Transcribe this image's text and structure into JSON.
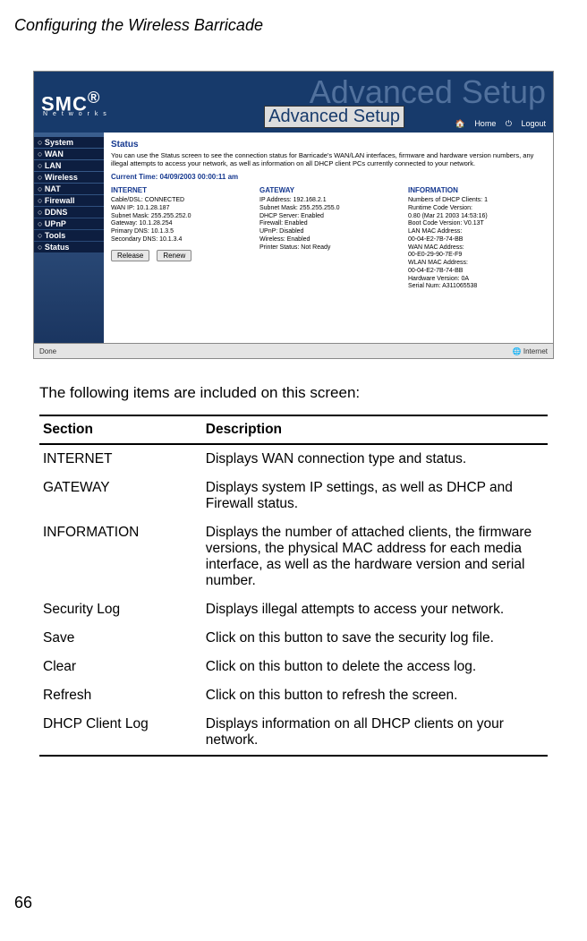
{
  "header": "Configuring the Wireless Barricade",
  "page_number": "66",
  "screenshot": {
    "brand": "SMC",
    "brand_sub": "N e t w o r k s",
    "watermark": "Advanced Setup",
    "watermark_label": "Advanced Setup",
    "nav_home": "Home",
    "nav_logout": "Logout",
    "sidebar_items": [
      "System",
      "WAN",
      "LAN",
      "Wireless",
      "NAT",
      "Firewall",
      "DDNS",
      "UPnP",
      "Tools",
      "Status"
    ],
    "title": "Status",
    "description": "You can use the Status screen to see the connection status for Barricade's WAN/LAN interfaces, firmware and hardware version numbers, any illegal attempts to access your network, as well as information on all DHCP client PCs currently connected to your network.",
    "current_time_label": "Current Time: 04/09/2003 00:00:11 am",
    "col_internet": {
      "head": "INTERNET",
      "lines": [
        "Cable/DSL: CONNECTED",
        "WAN IP: 10.1.28.187",
        "Subnet Mask: 255.255.252.0",
        "Gateway: 10.1.28.254",
        "Primary DNS: 10.1.3.5",
        "Secondary DNS: 10.1.3.4"
      ]
    },
    "col_gateway": {
      "head": "GATEWAY",
      "lines": [
        "IP Address: 192.168.2.1",
        "Subnet Mask: 255.255.255.0",
        "DHCP Server: Enabled",
        "Firewall: Enabled",
        "UPnP: Disabled",
        "Wireless: Enabled",
        "Printer Status: Not Ready"
      ]
    },
    "col_information": {
      "head": "INFORMATION",
      "lines": [
        "Numbers of DHCP Clients: 1",
        "Runtime Code Version:",
        " 0.80 (Mar 21 2003 14:53:16)",
        "Boot Code Version: V0.13T",
        "LAN MAC Address:",
        " 00-04-E2-7B-74-BB",
        "WAN MAC Address:",
        " 00-E0-29-90-7E-F9",
        "WLAN MAC Address:",
        " 00-04-E2-7B-74-BB",
        "Hardware Version: 0A",
        "Serial Num: A311065538"
      ]
    },
    "btn_release": "Release",
    "btn_renew": "Renew",
    "status_done": "Done",
    "status_zone": "Internet"
  },
  "body_para": "The following items are included on this screen:",
  "table": {
    "head_section": "Section",
    "head_desc": "Description",
    "rows": [
      {
        "section": "INTERNET",
        "desc": "Displays WAN connection type and status."
      },
      {
        "section": "GATEWAY",
        "desc": "Displays system IP settings, as well as DHCP and Firewall status."
      },
      {
        "section": "INFORMATION",
        "desc": "Displays the number of attached clients, the firmware versions, the physical MAC address for each media interface, as well as the hardware version and serial number."
      },
      {
        "section": "Security Log",
        "desc": "Displays illegal attempts to access your network."
      },
      {
        "section": "Save",
        "desc": "Click on this button to save the security log file."
      },
      {
        "section": "Clear",
        "desc": "Click on this button to delete the access log."
      },
      {
        "section": "Refresh",
        "desc": "Click on this button to refresh the screen."
      },
      {
        "section": "DHCP Client Log",
        "desc": "Displays information on all DHCP clients on your network."
      }
    ]
  }
}
